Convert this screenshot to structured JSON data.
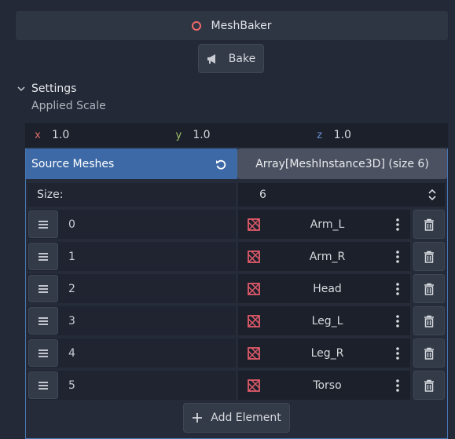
{
  "header": {
    "title": "MeshBaker",
    "node_icon": "circle-node-icon",
    "node_icon_color": "#ef6b6b"
  },
  "bake": {
    "label": "Bake",
    "icon": "megaphone-icon"
  },
  "settings": {
    "section_label": "Settings",
    "applied_scale": {
      "label": "Applied Scale",
      "x_label": "x",
      "x": "1.0",
      "y_label": "y",
      "y": "1.0",
      "z_label": "z",
      "z": "1.0",
      "axis_colors": {
        "x": "#e06c6c",
        "y": "#a3c26b",
        "z": "#6b8fd6"
      }
    }
  },
  "array": {
    "property_label": "Source Meshes",
    "type_label": "Array[MeshInstance3D] (size 6)",
    "size_label": "Size:",
    "size_value": "6",
    "accent_color": "#3d6aa6",
    "items": [
      {
        "index": "0",
        "name": "Arm_L"
      },
      {
        "index": "1",
        "name": "Arm_R"
      },
      {
        "index": "2",
        "name": "Head"
      },
      {
        "index": "3",
        "name": "Leg_L"
      },
      {
        "index": "4",
        "name": "Leg_R"
      },
      {
        "index": "5",
        "name": "Torso"
      }
    ],
    "add_label": "Add Element"
  }
}
